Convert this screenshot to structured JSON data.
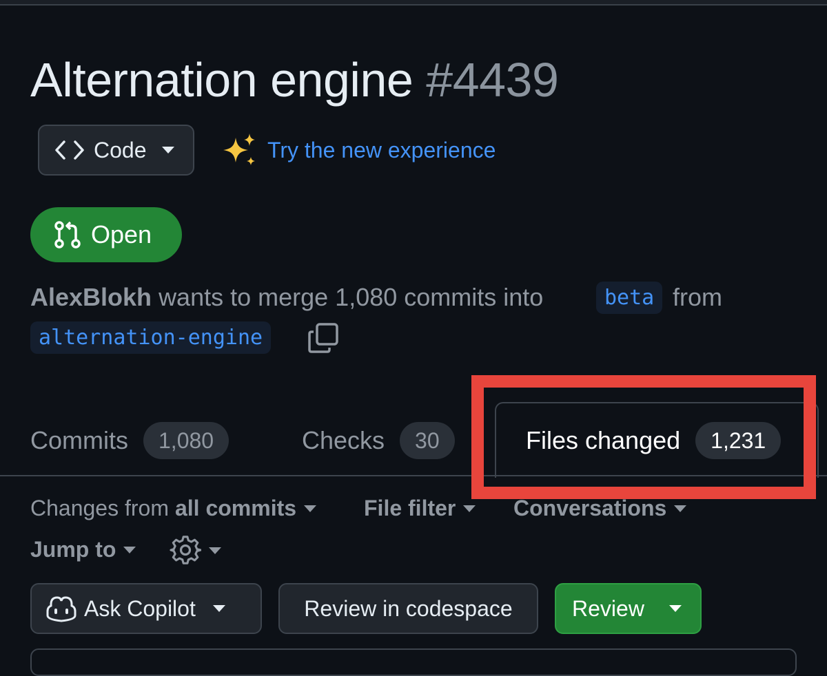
{
  "pr": {
    "title": "Alternation engine",
    "number": "#4439",
    "state": "Open",
    "author": "AlexBlokh",
    "merge_text": "wants to merge 1,080 commits into",
    "base_branch": "beta",
    "from_text": "from",
    "head_branch": "alternation-engine"
  },
  "toolbar": {
    "code_label": "Code",
    "try_new_label": "Try the new experience"
  },
  "tabs": [
    {
      "label": "Commits",
      "count": "1,080",
      "active": false
    },
    {
      "label": "Checks",
      "count": "30",
      "active": false
    },
    {
      "label": "Files changed",
      "count": "1,231",
      "active": true
    }
  ],
  "filters": {
    "changes_prefix": "Changes from",
    "changes_value": "all commits",
    "file_filter": "File filter",
    "conversations": "Conversations",
    "jump_to": "Jump to"
  },
  "actions": {
    "ask_copilot": "Ask Copilot",
    "review_codespace": "Review in codespace",
    "review": "Review"
  },
  "colors": {
    "background": "#0d1117",
    "open_green": "#238636",
    "link_blue": "#4493f8",
    "highlight_red": "#e8453c"
  }
}
